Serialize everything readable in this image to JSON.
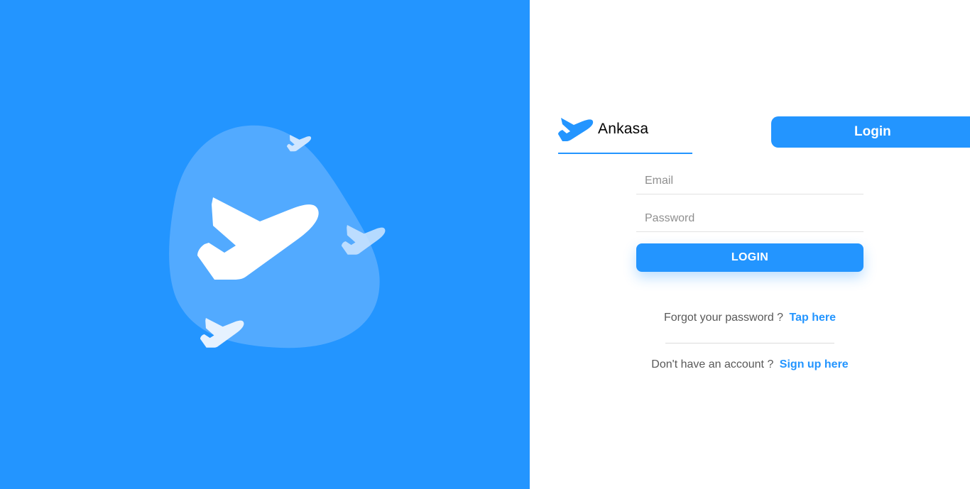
{
  "brand": {
    "name": "Ankasa",
    "logo_icon": "airplane-icon"
  },
  "tabs": {
    "login_label": "Login"
  },
  "form": {
    "email_placeholder": "Email",
    "email_value": "",
    "password_placeholder": "Password",
    "password_value": "",
    "submit_label": "LOGIN"
  },
  "forgot": {
    "text": "Forgot your password ?",
    "link": "Tap here"
  },
  "signup": {
    "text": "Don't have an account ?",
    "link": "Sign up here"
  },
  "hero": {
    "icons": [
      "airplane-icon",
      "airplane-icon",
      "airplane-icon",
      "airplane-icon"
    ]
  },
  "colors": {
    "primary": "#2395FF",
    "blob": "#5BAEFF",
    "text": "#595959",
    "white": "#FFFFFF"
  }
}
